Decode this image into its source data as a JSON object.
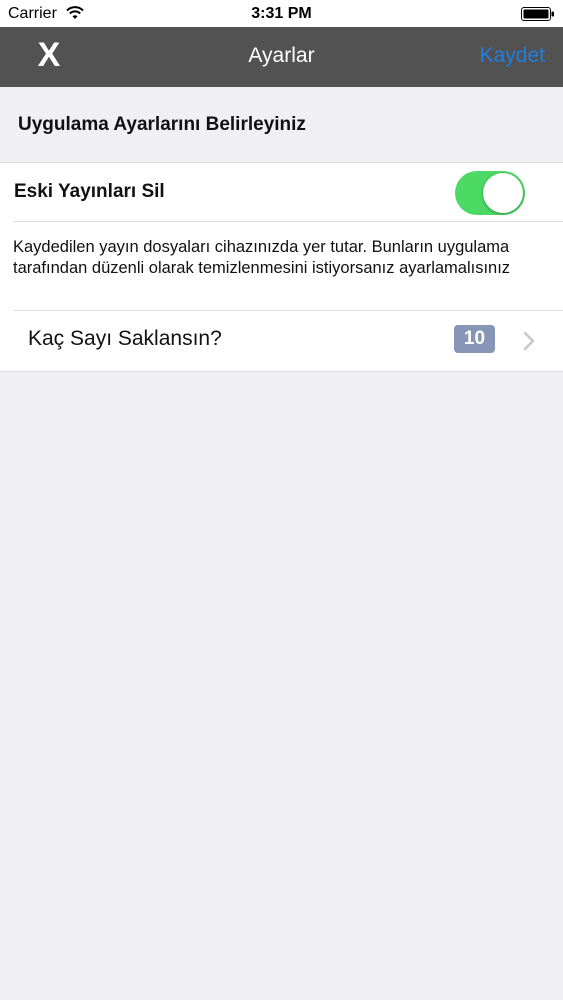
{
  "status_bar": {
    "carrier": "Carrier",
    "time": "3:31 PM"
  },
  "nav": {
    "close_label": "X",
    "title": "Ayarlar",
    "save_label": "Kaydet"
  },
  "section": {
    "header": "Uygulama Ayarlarını Belirleyiniz"
  },
  "settings": {
    "delete_old": {
      "label": "Eski Yayınları Sil",
      "enabled": true
    },
    "description": "Kaydedilen yayın dosyaları cihazınızda yer tutar. Bunların uygulama tarafından düzenli olarak temizlenmesini istiyorsanız ayarlamalısınız",
    "keep_count": {
      "label": "Kaç Sayı Saklansın?",
      "value": "10"
    }
  },
  "colors": {
    "nav_background": "#525252",
    "accent": "#1f7fe0",
    "switch_on": "#4cd964",
    "badge": "#8795b6",
    "background": "#efeff4"
  },
  "icons": {
    "wifi": "wifi-icon",
    "battery": "battery-icon",
    "chevron": "chevron-right-icon"
  }
}
